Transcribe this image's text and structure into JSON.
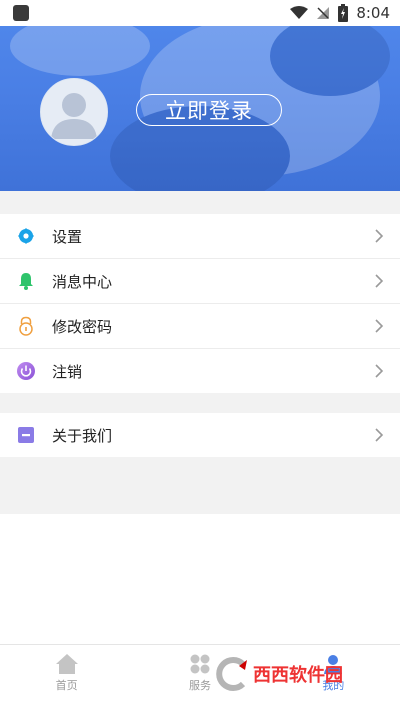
{
  "status_bar": {
    "time": "8:04"
  },
  "header": {
    "login_label": "立即登录"
  },
  "menu": {
    "group1": [
      {
        "label": "设置",
        "icon": "gear-icon",
        "color": "#1aa3e8"
      },
      {
        "label": "消息中心",
        "icon": "bell-icon",
        "color": "#2ec46b"
      },
      {
        "label": "修改密码",
        "icon": "lock-icon",
        "color": "#f0a040"
      },
      {
        "label": "注销",
        "icon": "power-icon",
        "color": "#a16be0"
      }
    ],
    "group2": [
      {
        "label": "关于我们",
        "icon": "info-card-icon",
        "color": "#8a7be6"
      }
    ]
  },
  "bottom_nav": [
    {
      "label": "首页",
      "icon": "home-icon"
    },
    {
      "label": "服务",
      "icon": "grid-icon"
    },
    {
      "label": "我的",
      "icon": "user-icon",
      "active": true
    }
  ],
  "watermark": {
    "text": "西西软件园"
  }
}
